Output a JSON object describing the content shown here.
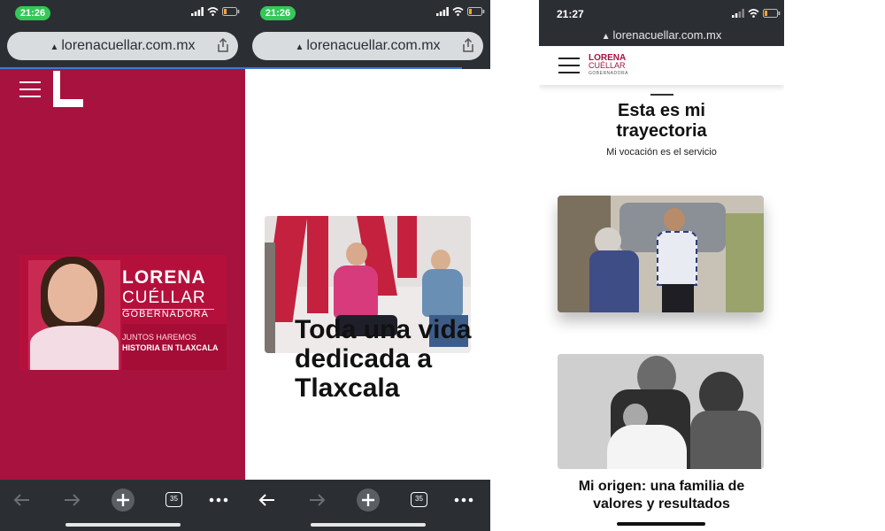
{
  "screens": [
    {
      "status_time": "21:26",
      "url": "lorenacuellar.com.mx",
      "tab_count": "35",
      "banner": {
        "name_line1": "LORENA",
        "name_line2": "CUÉLLAR",
        "role": "GOBERNADORA",
        "slogan_line1": "JUNTOS HAREMOS",
        "slogan_line2": "HISTORIA EN TLAXCALA"
      },
      "colors": {
        "brand": "#a8123f",
        "toolbar": "#2b2f34"
      }
    },
    {
      "status_time": "21:26",
      "url": "lorenacuellar.com.mx",
      "tab_count": "35",
      "headline": "Toda una vida dedicada a Tlaxcala"
    },
    {
      "status_time": "21:27",
      "url": "lorenacuellar.com.mx",
      "logo": {
        "line1": "LORENA",
        "line2": "CUÉLLAR",
        "line3": "GOBERNADORA"
      },
      "section_title": "Esta es mi trayectoria",
      "section_subtitle": "Mi vocación es el servicio",
      "photo_caption": "Mi origen: una familia de valores y resultados"
    }
  ]
}
